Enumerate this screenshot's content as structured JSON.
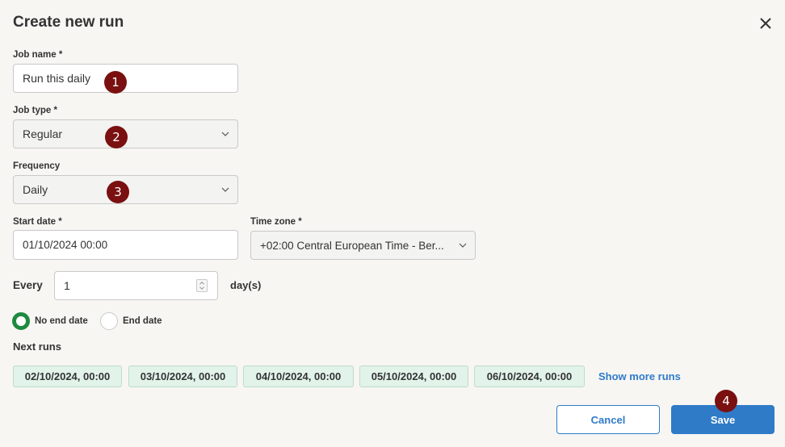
{
  "dialog": {
    "title": "Create new run"
  },
  "job_name": {
    "label": "Job name *",
    "value": "Run this daily"
  },
  "job_type": {
    "label": "Job type *",
    "value": "Regular"
  },
  "frequency": {
    "label": "Frequency",
    "value": "Daily"
  },
  "start_date": {
    "label": "Start date *",
    "value": "01/10/2024 00:00"
  },
  "time_zone": {
    "label": "Time zone *",
    "value": "+02:00 Central European Time - Ber..."
  },
  "every": {
    "label": "Every",
    "value": "1",
    "unit": "day(s)"
  },
  "end_options": {
    "no_end_date": "No end date",
    "end_date": "End date",
    "selected": "no_end_date"
  },
  "next_runs": {
    "label": "Next runs",
    "items": [
      "02/10/2024, 00:00",
      "03/10/2024, 00:00",
      "04/10/2024, 00:00",
      "05/10/2024, 00:00",
      "06/10/2024, 00:00"
    ],
    "show_more": "Show more runs"
  },
  "buttons": {
    "cancel": "Cancel",
    "save": "Save"
  },
  "step_badges": [
    "1",
    "2",
    "3",
    "4"
  ],
  "colors": {
    "primary": "#2f7bc8",
    "radio_checked": "#1f8a3f",
    "chip_bg": "#e2f3ea",
    "badge": "#7a1010"
  },
  "icons": {
    "close": "close-icon",
    "dropdown": "chevron-down-icon",
    "spinner": "number-spinner-icon"
  }
}
